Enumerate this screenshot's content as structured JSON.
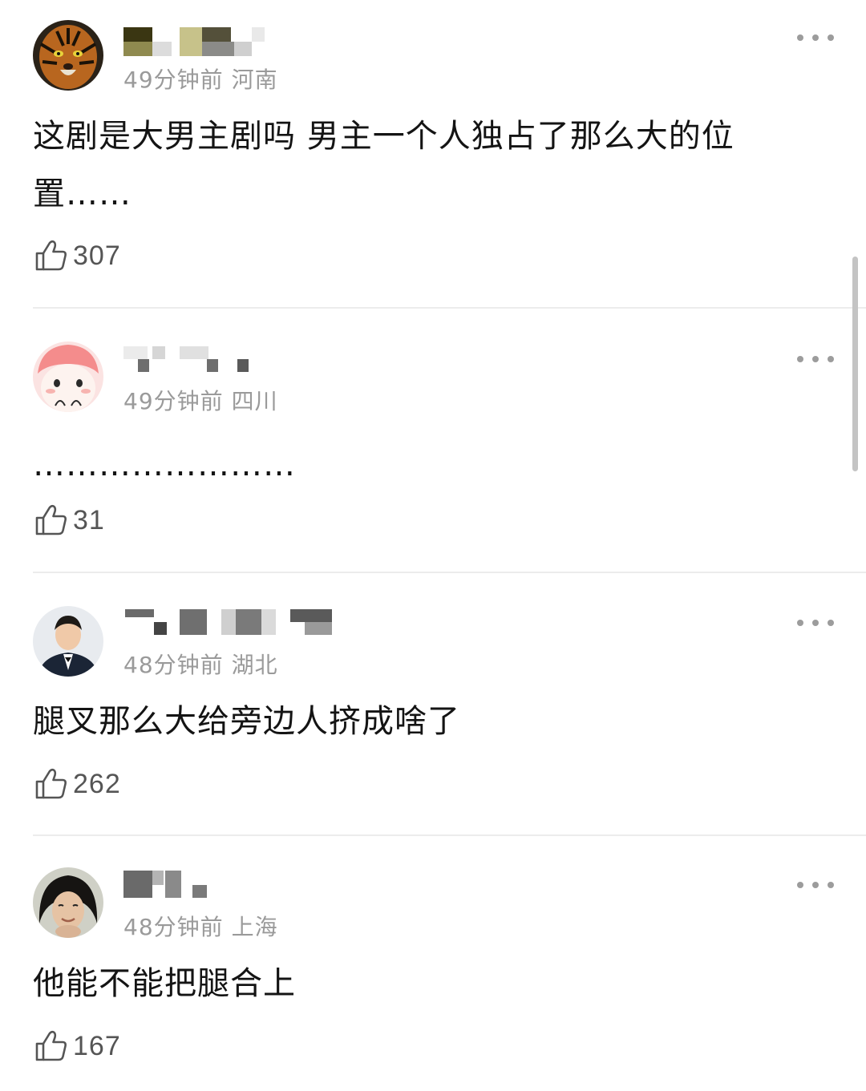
{
  "comments": [
    {
      "time": "49分钟前",
      "location": "河南",
      "text": "这剧是大男主剧吗  男主一个人独占了那么大的位置……",
      "likes": "307",
      "avatar": "tiger-avatar"
    },
    {
      "time": "49分钟前",
      "location": "四川",
      "text": "……………………",
      "likes": "31",
      "avatar": "cartoon-avatar"
    },
    {
      "time": "48分钟前",
      "location": "湖北",
      "text": "腿叉那么大给旁边人挤成啥了",
      "likes": "262",
      "avatar": "man-in-suit-avatar"
    },
    {
      "time": "48分钟前",
      "location": "上海",
      "text": "他能不能把腿合上",
      "likes": "167",
      "avatar": "woman-photo-avatar"
    }
  ],
  "icons": {
    "like": "thumbs-up-icon",
    "more": "more-dots-icon"
  },
  "colors": {
    "meta": "#9a9a9a",
    "text": "#141414",
    "divider": "#ececec"
  }
}
